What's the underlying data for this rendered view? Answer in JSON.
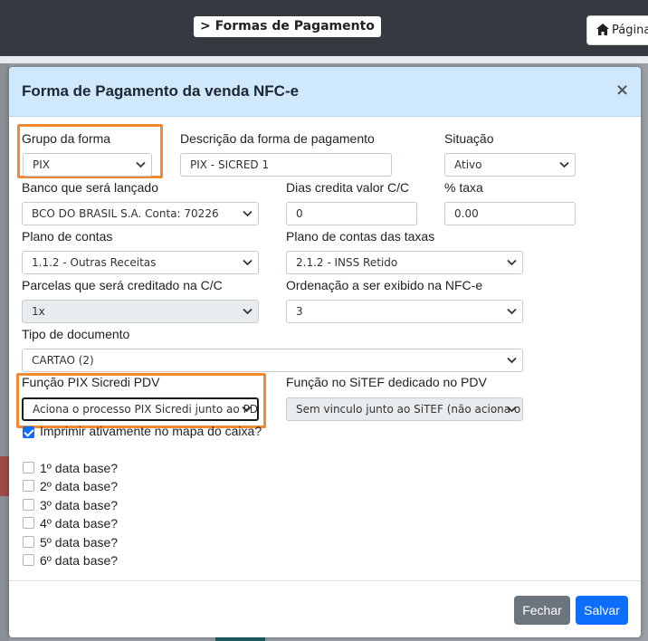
{
  "app": {
    "breadcrumb": "> Formas de Pagamento",
    "home_button": "Página"
  },
  "modal": {
    "title": "Forma de Pagamento da venda NFC-e",
    "close": "×",
    "fields": {
      "grupo": {
        "label": "Grupo da forma",
        "value": "PIX"
      },
      "descricao": {
        "label": "Descrição da forma de pagamento",
        "value": "PIX - SICRED 1"
      },
      "situacao": {
        "label": "Situação",
        "value": "Ativo"
      },
      "banco": {
        "label": "Banco que será lançado",
        "value": "BCO DO BRASIL S.A. Conta: 70226"
      },
      "dias": {
        "label": "Dias credita valor C/C",
        "value": "0"
      },
      "taxa": {
        "label": "% taxa",
        "value": "0.00"
      },
      "plano": {
        "label": "Plano de contas",
        "value": "1.1.2 - Outras Receitas"
      },
      "plano_taxas": {
        "label": "Plano de contas das taxas",
        "value": "2.1.2 - INSS Retido"
      },
      "parcelas": {
        "label": "Parcelas que será creditado na C/C",
        "value": "1x"
      },
      "ordenacao": {
        "label": "Ordenação a ser exibido na NFC-e",
        "value": "3"
      },
      "tipo_doc": {
        "label": "Tipo de documento",
        "value": "CARTAO (2)"
      },
      "funcao_pix": {
        "label": "Função PIX Sicredi PDV",
        "value": "Aciona o processo PIX Sicredi junto ao PDV"
      },
      "funcao_sitef": {
        "label": "Função no SiTEF dedicado no PDV",
        "value": "Sem vinculo junto ao SiTEF (não aciona o serviço)"
      }
    },
    "imprimir": {
      "label": "Imprimir ativamente no mapa do caixa?",
      "checked": true
    },
    "data_bases": [
      {
        "label": "1º data base?",
        "checked": false
      },
      {
        "label": "2º data base?",
        "checked": false
      },
      {
        "label": "3º data base?",
        "checked": false
      },
      {
        "label": "4º data base?",
        "checked": false
      },
      {
        "label": "5º data base?",
        "checked": false
      },
      {
        "label": "6º data base?",
        "checked": false
      }
    ],
    "buttons": {
      "fechar": "Fechar",
      "salvar": "Salvar"
    }
  },
  "colors": {
    "header_bg": "#cfe8fb",
    "highlight": "#f08a32",
    "primary": "#0d6efd",
    "secondary": "#6c757d",
    "topbar": "#343a40"
  }
}
